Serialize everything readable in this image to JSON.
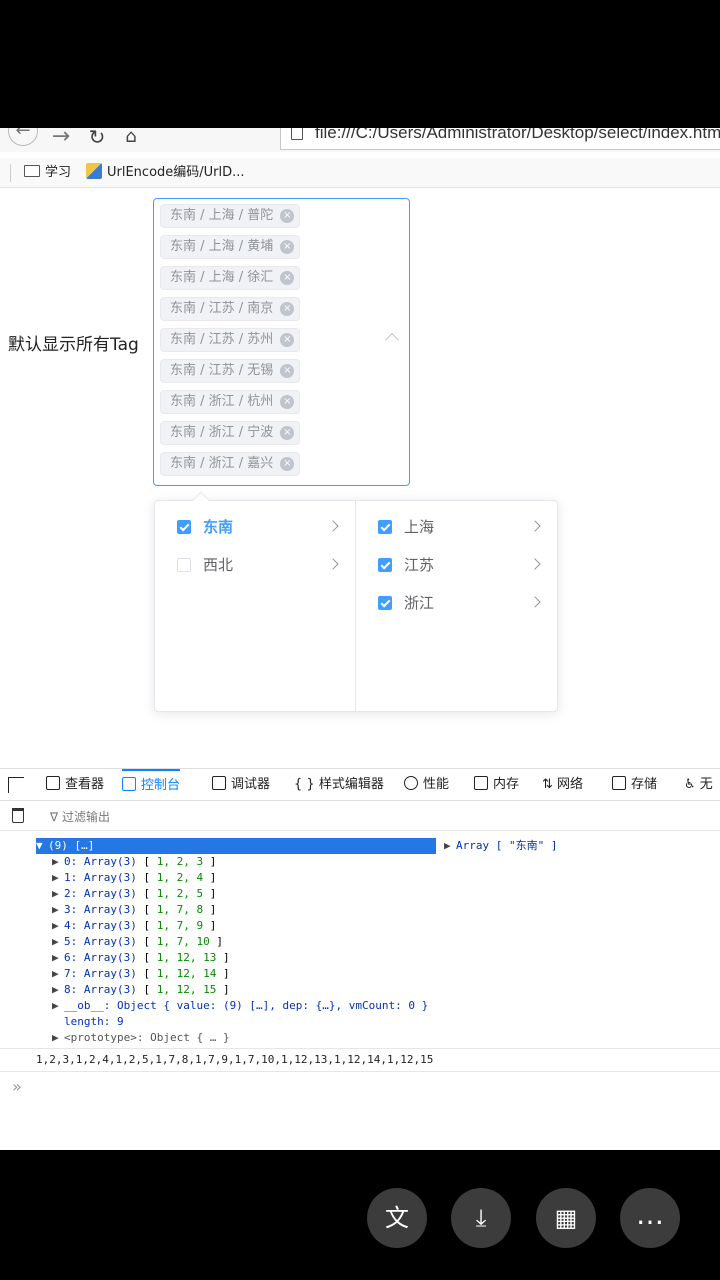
{
  "browser": {
    "url": "file:///C:/Users/Administrator/Desktop/select/index.html",
    "bookmarks": [
      "学习",
      "UrlEncode编码/UrlD..."
    ]
  },
  "form": {
    "label": "默认显示所有Tag",
    "tags": [
      "东南 / 上海 / 普陀",
      "东南 / 上海 / 黄埔",
      "东南 / 上海 / 徐汇",
      "东南 / 江苏 / 南京",
      "东南 / 江苏 / 苏州",
      "东南 / 江苏 / 无锡",
      "东南 / 浙江 / 杭州",
      "东南 / 浙江 / 宁波",
      "东南 / 浙江 / 嘉兴"
    ],
    "menu1": [
      {
        "label": "东南",
        "checked": true,
        "active": true
      },
      {
        "label": "西北",
        "checked": false,
        "active": false
      }
    ],
    "menu2": [
      {
        "label": "上海",
        "checked": true
      },
      {
        "label": "江苏",
        "checked": true
      },
      {
        "label": "浙江",
        "checked": true
      }
    ]
  },
  "devtools": {
    "tabs": [
      "查看器",
      "控制台",
      "调试器",
      "样式编辑器",
      "性能",
      "内存",
      "网络",
      "存储",
      "无"
    ],
    "active_tab": "控制台",
    "filter_placeholder": "过滤输出",
    "console": {
      "header": "(9) […]",
      "right": "Array [ \"东南\" ]",
      "entries": [
        {
          "index": "0: Array(3)",
          "values": "1, 2, 3"
        },
        {
          "index": "1: Array(3)",
          "values": "1, 2, 4"
        },
        {
          "index": "2: Array(3)",
          "values": "1, 2, 5"
        },
        {
          "index": "3: Array(3)",
          "values": "1, 7, 8"
        },
        {
          "index": "4: Array(3)",
          "values": "1, 7, 9"
        },
        {
          "index": "5: Array(3)",
          "values": "1, 7, 10"
        },
        {
          "index": "6: Array(3)",
          "values": "1, 12, 13"
        },
        {
          "index": "7: Array(3)",
          "values": "1, 12, 14"
        },
        {
          "index": "8: Array(3)",
          "values": "1, 12, 15"
        }
      ],
      "ob_line": "__ob__: Object { value: (9) […], dep: {…}, vmCount: 0 }",
      "length_line": "length: 9",
      "proto_line": "<prototype>: Object { … }",
      "output": "1,2,3,1,2,4,1,2,5,1,7,8,1,7,9,1,7,10,1,12,13,1,12,14,1,12,15",
      "prompt": "»"
    }
  },
  "phone_buttons": [
    "translate-icon",
    "download-icon",
    "apps-grid-icon",
    "more-icon"
  ]
}
